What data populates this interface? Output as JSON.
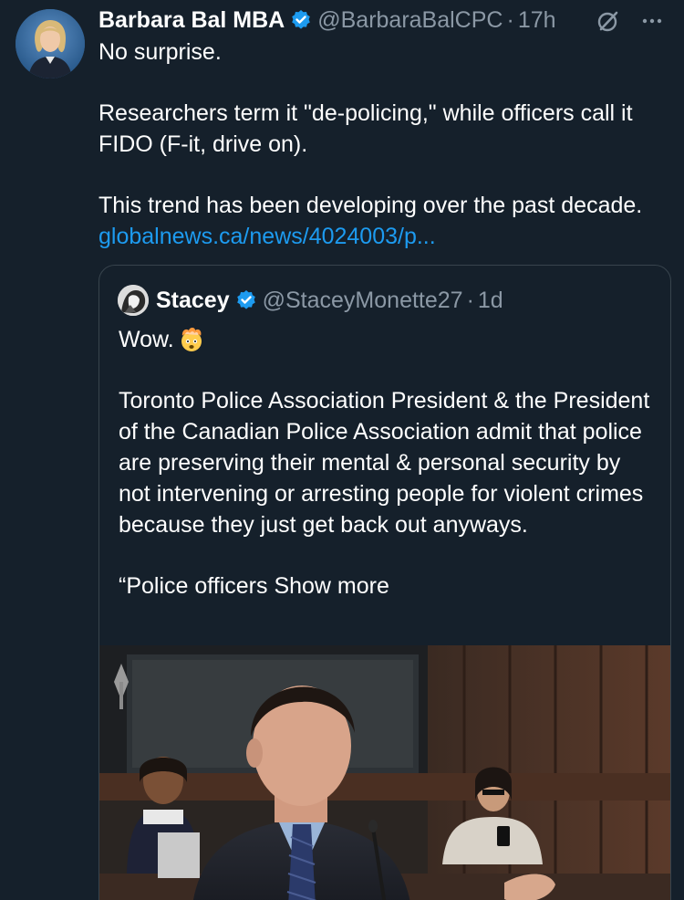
{
  "tweet": {
    "author": {
      "display_name": "Barbara Bal MBA",
      "handle": "@BarbaraBalCPC",
      "time": "17h",
      "separator": "·"
    },
    "text": {
      "line1": "No surprise.",
      "line2": "Researchers term it \"de-policing,\" while officers call it FIDO (F-it, drive on).",
      "line3": "This trend has been developing over the past decade.",
      "link": "globalnews.ca/news/4024003/p..."
    },
    "icons": {
      "verified": "verified-badge-icon",
      "grok": "grok-icon",
      "more": "more-icon"
    }
  },
  "quoted": {
    "author": {
      "display_name": "Stacey",
      "handle": "@StaceyMonette27",
      "time": "1d",
      "separator": "·"
    },
    "text": {
      "line1": "Wow.",
      "emoji": "🤯",
      "line2": "Toronto Police Association President & the President of the Canadian Police Association admit that police are preserving their mental & personal security by not intervening or arresting people for violent crimes because they just get back out anyways.",
      "line3_start": "“Police officers",
      "show_more": "Show more"
    }
  },
  "colors": {
    "background": "#15202b",
    "text": "#ffffff",
    "muted": "#8b98a5",
    "link": "#1d9bf0",
    "border": "#38444d"
  }
}
